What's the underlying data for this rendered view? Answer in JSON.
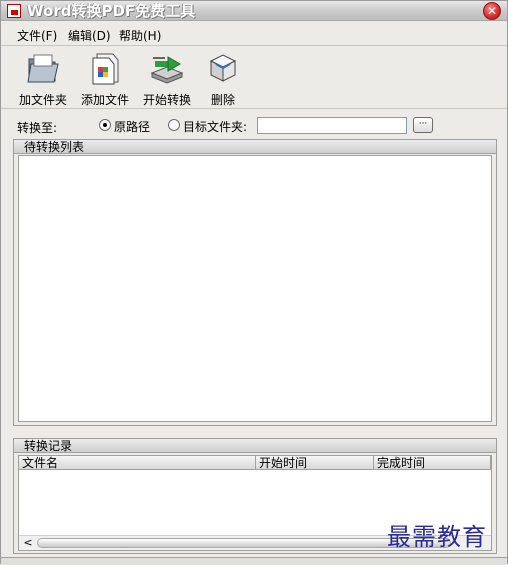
{
  "window": {
    "title": "Word转换PDF免费工具"
  },
  "menu": [
    "文件(F)",
    "编辑(D)",
    "帮助(H)"
  ],
  "toolbar": {
    "add_folder": "加文件夹",
    "add_file": "添加文件",
    "start": "开始转换",
    "delete": "删除"
  },
  "destination": {
    "label": "转换至:",
    "original_path": "原路径",
    "target_folder": "目标文件夹:",
    "selected": "original_path",
    "folder_value": "",
    "browse_label": "···"
  },
  "pending": {
    "title": "待转换列表"
  },
  "log": {
    "title": "转换记录",
    "columns": [
      "文件名",
      "开始时间",
      "完成时间"
    ],
    "scroll_left": "<"
  },
  "watermark": "最需教育",
  "icons": {
    "app": "pdf-app-icon",
    "close": "close-icon",
    "add_folder": "folder-icon",
    "add_file": "document-icon",
    "start": "convert-arrow-icon",
    "delete": "delete-box-icon"
  }
}
